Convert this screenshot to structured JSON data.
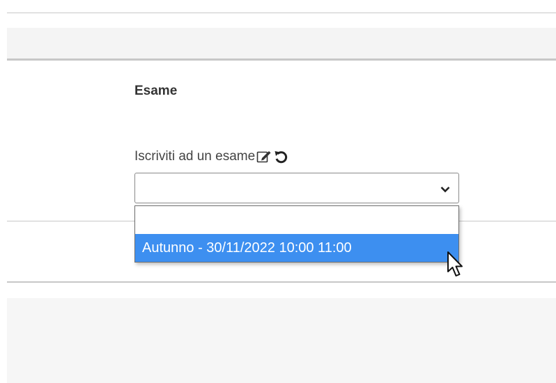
{
  "section": {
    "title": "Esame"
  },
  "field": {
    "label": "Iscriviti ad un esame",
    "edit_icon": "edit-icon",
    "reset_icon": "undo-icon",
    "selected_value": ""
  },
  "dropdown": {
    "options": [
      "",
      "Autunno - 30/11/2022 10:00 11:00"
    ],
    "highlighted_index": 1
  },
  "colors": {
    "highlight": "#3d8ff0",
    "band": "#f4f4f4",
    "divider": "#c8c8c8"
  }
}
